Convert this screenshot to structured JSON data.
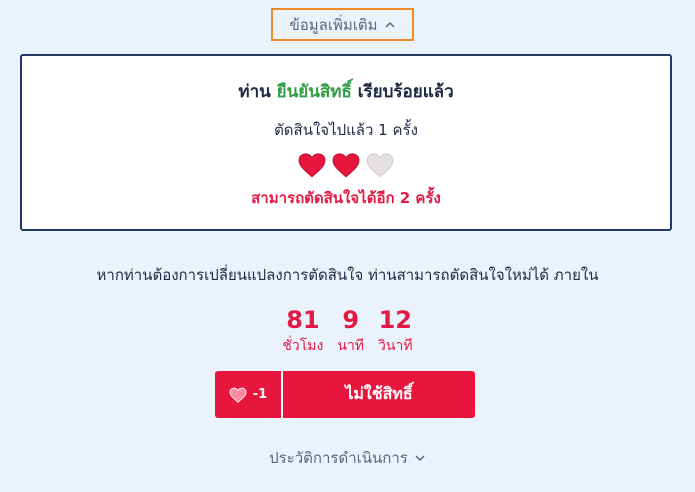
{
  "more_info": {
    "label": "ข้อมูลเพิ่มเติม",
    "icon": "chevron-up-icon"
  },
  "status": {
    "prefix": "ท่าน",
    "action": "ยืนยันสิทธิ์",
    "suffix": "เรียบร้อยแล้ว",
    "decided_text": "ตัดสินใจไปแล้ว 1 ครั้ง",
    "hearts": {
      "total": 3,
      "filled": 2,
      "filled_color": "#e8163d",
      "empty_color": "#e6e1e1"
    },
    "remaining_text": "สามารถตัดสินใจได้อีก 2 ครั้ง"
  },
  "change_message": "หากท่านต้องการเปลี่ยนแปลงการตัดสินใจ ท่านสามารถตัดสินใจใหม่ได้ ภายใน",
  "countdown": {
    "hours": {
      "value": "81",
      "label": "ชั่วโมง"
    },
    "minutes": {
      "value": "9",
      "label": "นาที"
    },
    "seconds": {
      "value": "12",
      "label": "วินาที"
    }
  },
  "reject_button": {
    "cost": "-1",
    "label": "ไม่ใช้สิทธิ์",
    "icon": "heart-icon"
  },
  "history": {
    "label": "ประวัติการดำเนินการ",
    "icon": "chevron-down-icon"
  },
  "colors": {
    "accent": "#e8163d",
    "success": "#2f9e44",
    "border": "#1f3a68",
    "highlight": "#f08a24"
  }
}
